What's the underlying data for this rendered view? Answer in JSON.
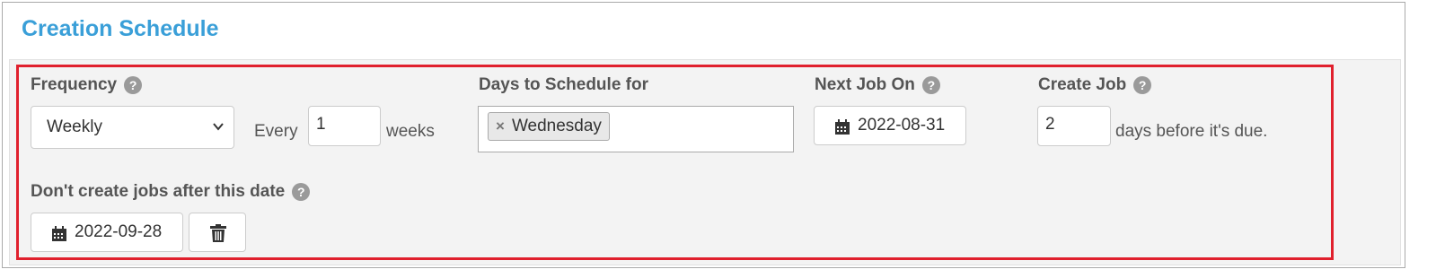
{
  "title": "Creation Schedule",
  "frequency": {
    "label": "Frequency",
    "selected": "Weekly",
    "every_label": "Every",
    "every_value": "1",
    "unit_label": "weeks"
  },
  "days": {
    "label": "Days to Schedule for",
    "tags": [
      "Wednesday"
    ],
    "remove_glyph": "×"
  },
  "next_job": {
    "label": "Next Job On",
    "date": "2022-08-31"
  },
  "create_job": {
    "label": "Create Job",
    "value": "2",
    "suffix": "days before it's due."
  },
  "end_date": {
    "label": "Don't create jobs after this date",
    "date": "2022-09-28"
  },
  "help_glyph": "?",
  "colors": {
    "title": "#3a9fd8",
    "highlight": "#e0202d",
    "section_bg": "#f3f3f3"
  }
}
